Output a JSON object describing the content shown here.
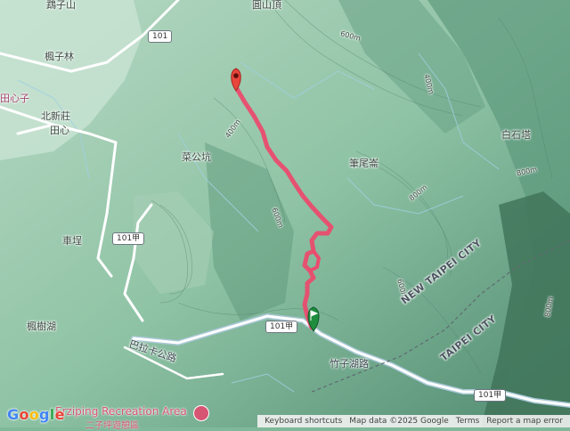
{
  "map": {
    "colors": {
      "route": "#ea4c6e",
      "end_marker": "#e8453c",
      "start_marker": "#1e8e3e",
      "water": "#a6cad9",
      "road": "#ffffff"
    },
    "place_labels": [
      {
        "id": "wuzishan",
        "text": "鵡子山"
      },
      {
        "id": "yuanshanding",
        "text": "圓山頂"
      },
      {
        "id": "fengzilin",
        "text": "楓子林"
      },
      {
        "id": "tianxinzi",
        "text": "田心子"
      },
      {
        "id": "beixinzhuang",
        "text": "北新莊"
      },
      {
        "id": "tianxin",
        "text": "田心"
      },
      {
        "id": "caigongkeng",
        "text": "菜公坑"
      },
      {
        "id": "bishuilun",
        "text": "筆尾崙"
      },
      {
        "id": "baishilao",
        "text": "白石塔"
      },
      {
        "id": "chepu",
        "text": "車埕"
      },
      {
        "id": "fengshuhu",
        "text": "楓樹湖"
      },
      {
        "id": "zhuzihu",
        "text": "竹子湖路"
      },
      {
        "id": "balaka",
        "text": "巴拉卡公路"
      }
    ],
    "city_labels": [
      {
        "id": "ntc",
        "text": "NEW TAIPEI CITY"
      },
      {
        "id": "tpc",
        "text": "TAIPEI CITY"
      }
    ],
    "contour_labels": [
      "400m",
      "600m",
      "800m",
      "800m",
      "600m",
      "400m",
      "600m",
      "800m"
    ],
    "road_shields": [
      {
        "id": "r101a",
        "text": "101"
      },
      {
        "id": "r101b",
        "text": "101甲"
      },
      {
        "id": "r101c",
        "text": "101甲"
      },
      {
        "id": "r101d",
        "text": "101甲"
      }
    ],
    "recreation_area": {
      "name": "Erziping Recreation Area",
      "subname": "二子坪遊憩區"
    },
    "google_logo": "Google",
    "footer": {
      "shortcuts": "Keyboard shortcuts",
      "data": "Map data ©2025 Google",
      "terms": "Terms",
      "report": "Report a map error"
    }
  }
}
